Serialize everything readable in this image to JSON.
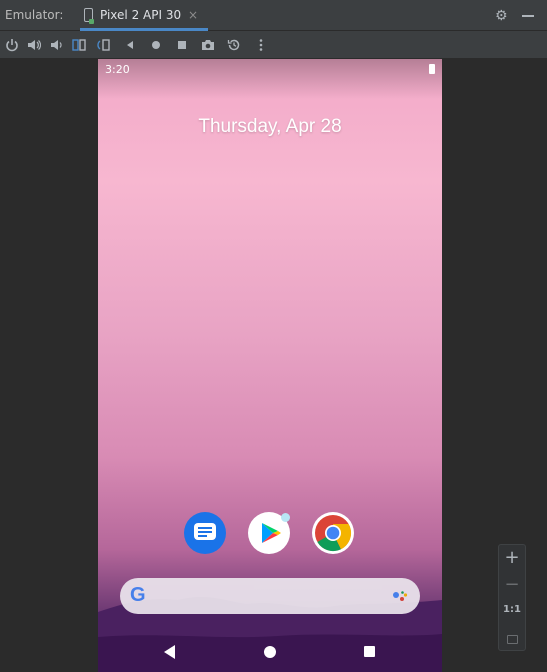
{
  "tool_window": {
    "label": "Emulator:",
    "tab": {
      "name": "Pixel 2 API 30",
      "close_glyph": "×"
    },
    "settings_icon": "gear-icon",
    "minimize_icon": "minimize-icon",
    "accent_color": "#4a88c7"
  },
  "toolbar": {
    "items": [
      {
        "name": "power-button",
        "icon": "power-icon"
      },
      {
        "name": "volume-up-button",
        "icon": "volume-up-icon"
      },
      {
        "name": "volume-down-button",
        "icon": "volume-down-icon"
      },
      {
        "name": "rotate-left-button",
        "icon": "rotate-left-icon"
      },
      {
        "name": "rotate-right-button",
        "icon": "rotate-right-icon"
      },
      {
        "name": "back-button",
        "icon": "triangle-back-icon"
      },
      {
        "name": "home-button",
        "icon": "circle-home-icon"
      },
      {
        "name": "overview-button",
        "icon": "square-overview-icon"
      },
      {
        "name": "screenshot-button",
        "icon": "camera-icon"
      },
      {
        "name": "snapshot-button",
        "icon": "snapshot-history-icon"
      },
      {
        "name": "more-button",
        "icon": "more-vertical-icon"
      }
    ]
  },
  "device": {
    "status_time": "3:20",
    "date": "Thursday, Apr 28",
    "apps": [
      {
        "name": "Messages",
        "icon": "messages-icon"
      },
      {
        "name": "Play Store",
        "icon": "play-store-icon"
      },
      {
        "name": "Chrome",
        "icon": "chrome-icon"
      }
    ],
    "search_logo": "G",
    "nav": [
      "back",
      "home",
      "recents"
    ]
  },
  "zoom_panel": {
    "zoom_in": "+",
    "zoom_out": "−",
    "one_to_one": "1:1",
    "fit_icon": "fit-screen-icon"
  }
}
